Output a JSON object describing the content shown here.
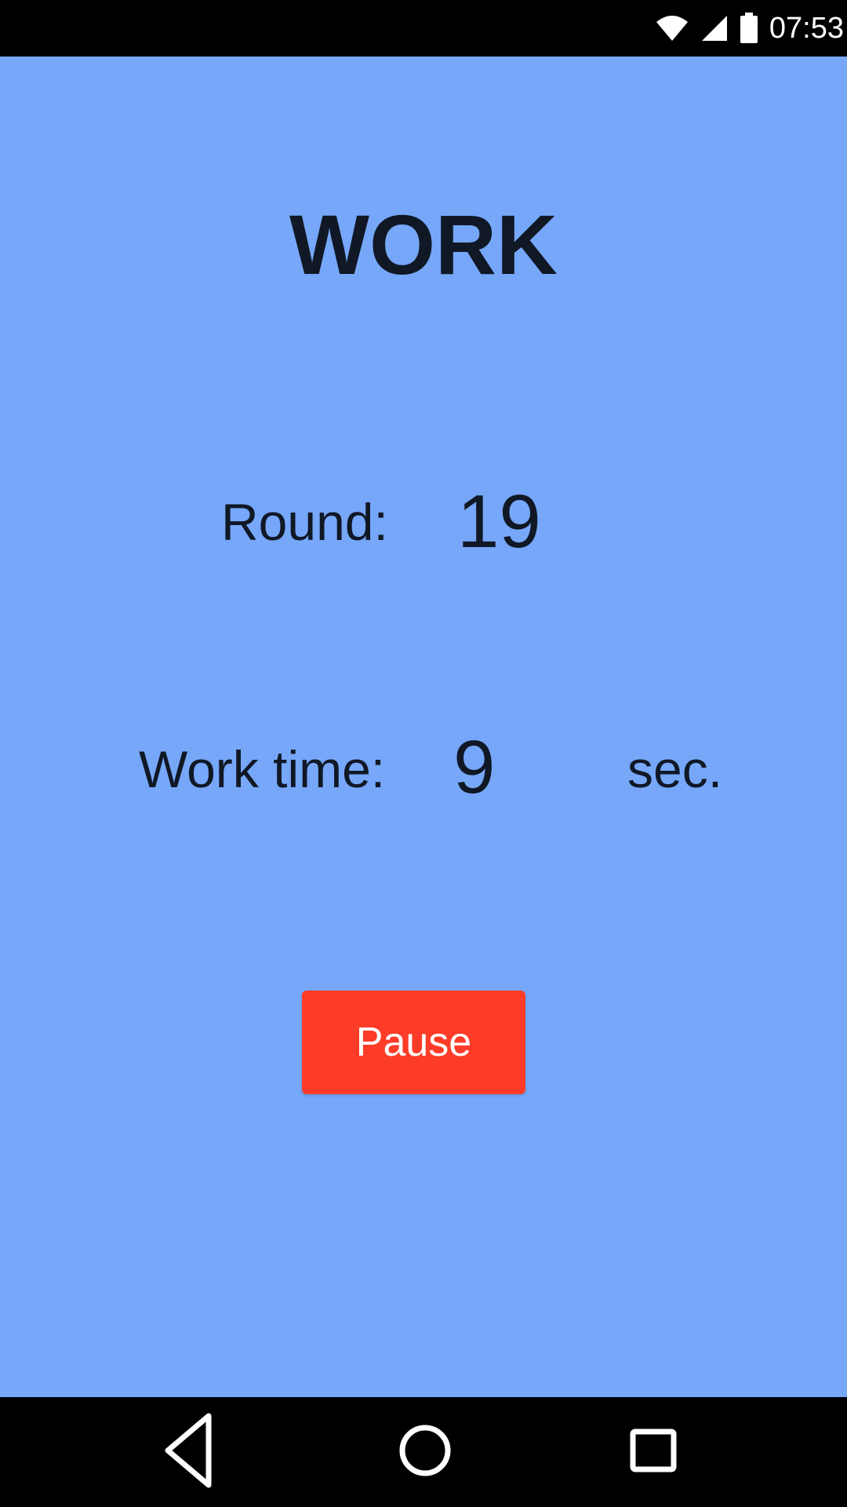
{
  "status_bar": {
    "time": "07:53",
    "icons": [
      "wifi-icon",
      "cell-signal-icon",
      "battery-icon"
    ]
  },
  "screen": {
    "phase_title": "WORK",
    "round_label": "Round:",
    "round_value": "19",
    "work_time_label": "Work time:",
    "work_time_value": "9",
    "work_time_unit": "sec.",
    "pause_label": "Pause"
  },
  "nav_bar": {
    "buttons": [
      "back-icon",
      "home-icon",
      "recents-icon"
    ]
  },
  "colors": {
    "background": "#76a7f8",
    "pause_button": "#fc3c28",
    "text": "#101826"
  }
}
